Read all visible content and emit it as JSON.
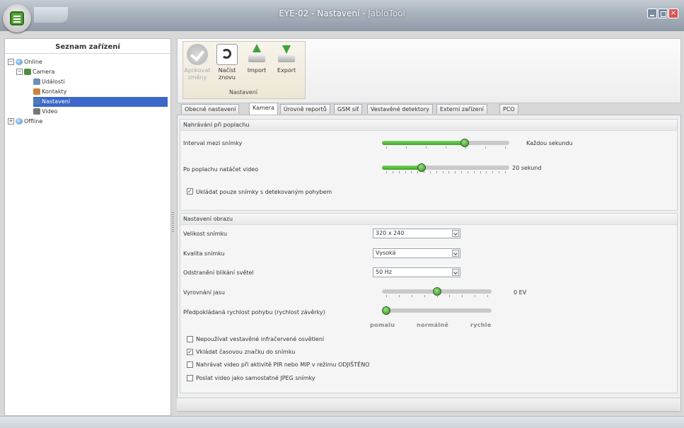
{
  "window": {
    "title_main": "EYE-02 - Nastavení - ",
    "title_app": "JabloTool",
    "close_glyph": "×"
  },
  "left_panel": {
    "title": "Seznam zařízení",
    "tree": {
      "online": "Online",
      "camera": "Camera",
      "udalosti": "Události",
      "kontakty": "Kontakty",
      "nastaveni": "Nastavení",
      "video": "Video",
      "offline": "Offline",
      "collapse_glyph": "−",
      "expand_glyph": "+"
    }
  },
  "ribbon": {
    "apply": "Aplikovat změny",
    "reload": "Načíst znovu",
    "import": "Import",
    "export": "Export",
    "group_label": "Nastavení"
  },
  "tabs": [
    "Obecné nastavení",
    "Kamera",
    "Úrovně reportů",
    "GSM síť",
    "Vestavěné detektory",
    "Externí zařízení",
    "PCO"
  ],
  "active_tab": 1,
  "recording": {
    "header": "Nahrávání při poplachu",
    "interval_label": "Interval mezi snímky",
    "interval_value": "Každou sekundu",
    "interval_level": 0.66,
    "video_label": "Po poplachu natáčet video",
    "video_value": "20 sekund",
    "video_level": 0.3,
    "motion_only_label": "Ukládat pouze snímky s detekovaným pohybem",
    "motion_only_checked": true,
    "check_glyph": "✓"
  },
  "image": {
    "header": "Nastavení obrazu",
    "size_label": "Velikost snímku",
    "size_value": "320 x 240",
    "quality_label": "Kvalita snímku",
    "quality_value": "Vysoká",
    "flicker_label": "Odstranění blikání světel",
    "flicker_value": "50 Hz",
    "brightness_label": "Vyrovnání jasu",
    "brightness_value": "0 EV",
    "brightness_level": 0.5,
    "speed_label": "Předpokládaná rychlost pohybu (rychlost závěrky)",
    "speed_level": 0.0,
    "speed_slow": "pomalu",
    "speed_normal": "normálně",
    "speed_fast": "rychle",
    "opt_ir": "Nepoužívat vestavěné infračervené osvětlení",
    "opt_ir_checked": false,
    "opt_timestamp": "Vkládat časovou značku do snímku",
    "opt_timestamp_checked": true,
    "opt_pir": "Nahrávat video při aktivitě PIR nebo MIP v režimu ODJIŠTĚNO",
    "opt_pir_checked": false,
    "opt_jpeg": "Poslat video jako samostatné JPEG snímky",
    "opt_jpeg_checked": false
  }
}
